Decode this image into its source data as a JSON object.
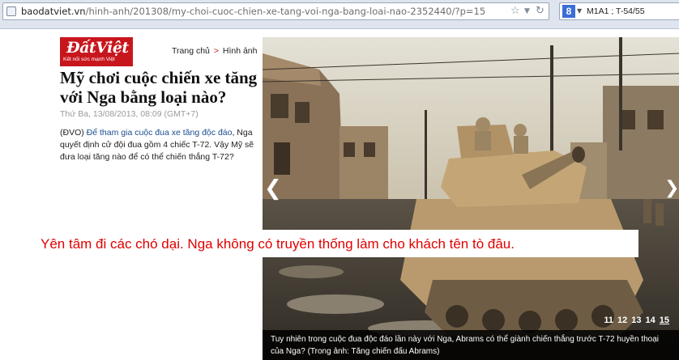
{
  "browser": {
    "url_domain": "baodatviet.vn",
    "url_path": "/hinh-anh/201308/my-choi-cuoc-chien-xe-tang-voi-nga-bang-loai-nao-2352440/?p=15",
    "star_icon": "star-icon",
    "dropdown_icon": "dropdown-arrow-icon",
    "refresh_icon": "refresh-icon",
    "search_engine_icon": "google-icon",
    "search_engine_letter": "8",
    "search_value": "M1A1 ; T-54/55"
  },
  "site": {
    "logo_text": "ĐấtViệt",
    "logo_tagline": "Kết nối sức mạnh Việt",
    "brand_color": "#c8161d",
    "breadcrumb": {
      "home": "Trang chủ",
      "separator": ">",
      "section": "Hình ảnh"
    }
  },
  "article": {
    "title": "Mỹ chơi cuộc chiến xe tăng với Nga bằng loại nào?",
    "date": "Thứ Ba, 13/08/2013, 08:09 (GMT+7)",
    "summary_prefix": "(ĐVO) ",
    "summary_link": "Để tham gia cuộc đua xe tăng độc đáo",
    "summary_rest": ", Nga quyết định cử đội đua gồm 4 chiếc T-72. Vậy Mỹ sẽ đưa loại tăng nào để có thể chiến thắng T-72?"
  },
  "gallery": {
    "prev_icon": "chevron-left-icon",
    "next_icon": "chevron-right-icon",
    "pages": [
      "11",
      "12",
      "13",
      "14",
      "15"
    ],
    "current_page": "15",
    "caption": "Tuy nhiên trong cuộc đua độc đáo lần này với Nga, Abrams có thể giành chiến thắng trước T-72 huyền thoại của Nga? (Trong ảnh: Tăng chiến đấu Abrams)"
  },
  "overlay_comment": {
    "text": "Yên tâm đi các chó dại. Nga không có truyền thống làm cho khách tên tò đâu.",
    "color": "#e00000"
  }
}
